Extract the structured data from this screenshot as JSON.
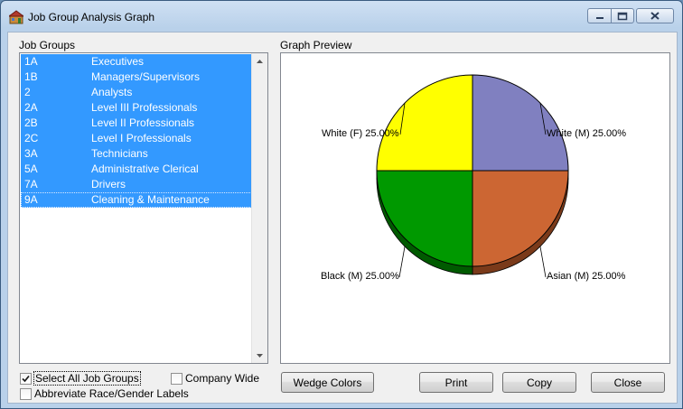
{
  "window": {
    "title": "Job Group Analysis Graph"
  },
  "job_groups": {
    "label": "Job Groups",
    "items": [
      {
        "code": "1A",
        "name": "Executives"
      },
      {
        "code": "1B",
        "name": "Managers/Supervisors"
      },
      {
        "code": "2",
        "name": "Analysts"
      },
      {
        "code": "2A",
        "name": "Level III Professionals"
      },
      {
        "code": "2B",
        "name": "Level II Professionals"
      },
      {
        "code": "2C",
        "name": "Level I Professionals"
      },
      {
        "code": "3A",
        "name": "Technicians"
      },
      {
        "code": "5A",
        "name": "Administrative Clerical"
      },
      {
        "code": "7A",
        "name": "Drivers"
      },
      {
        "code": "9A",
        "name": "Cleaning & Maintenance"
      }
    ]
  },
  "graph": {
    "label": "Graph Preview",
    "slices": [
      {
        "label": "White (M) 25.00%",
        "value": 25.0,
        "color": "#8080c0",
        "side": "#5a5a8c"
      },
      {
        "label": "Asian (M) 25.00%",
        "value": 25.0,
        "color": "#cc6633",
        "side": "#7a3a1a"
      },
      {
        "label": "Black (M) 25.00%",
        "value": 25.0,
        "color": "#009900",
        "side": "#005a00"
      },
      {
        "label": "White (F) 25.00%",
        "value": 25.0,
        "color": "#ffff00",
        "side": "#8a8a00"
      }
    ]
  },
  "options": {
    "select_all": {
      "label": "Select All Job Groups",
      "checked": true
    },
    "company_wide": {
      "label": "Company Wide",
      "checked": false
    },
    "abbreviate": {
      "label": "Abbreviate Race/Gender Labels",
      "checked": false
    }
  },
  "buttons": {
    "wedge_colors": "Wedge Colors",
    "print": "Print",
    "copy": "Copy",
    "close": "Close"
  }
}
